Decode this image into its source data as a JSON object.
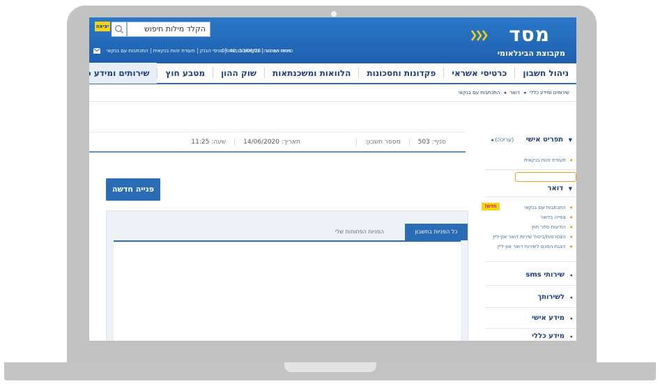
{
  "header": {
    "brand_name": "מסד",
    "brand_subtitle": "מקבוצת הבינלאומי",
    "search_placeholder": "הקלד מילות חיפוש",
    "exit_label": "יציאה",
    "last_login_label": "כניסה אחרונה:",
    "last_login_value": "10/06/20 ,08:40",
    "quick_links": [
      "פניות הציבור",
      "בנקאות בנחמה",
      "סניפי הבנק",
      "תעודת זהות בנקאית",
      "התכתבות עם בנקאי"
    ]
  },
  "mainnav": {
    "items": [
      "ניהול חשבון",
      "כרטיסי אשראי",
      "פקדונות וחסכונות",
      "הלוואות ומשכנתאות",
      "שוק ההון",
      "מטבע חוץ",
      "שירותים ומידע כללי"
    ]
  },
  "breadcrumb": [
    "שירותים ומידע כללי",
    "דואר",
    "התכתבות עם בנקאי"
  ],
  "info_bar": {
    "branch_label": "סניף:",
    "branch_value": "503",
    "account_label": "מספר חשבון:",
    "account_value": "",
    "date_label": "תאריך:",
    "date_value": "14/06/2020",
    "time_label": "שעה:",
    "time_value": "11:25"
  },
  "side": {
    "personal_profile": "תפריט אישי",
    "edit_label": "(עריכה)",
    "id_link": "תעודת זהות בנקאית",
    "mail_heading": "דואר",
    "mail_links": [
      "התכתבות עם בנקאי",
      "צפייה בדואר",
      "הודעות סחר חוץ",
      "הצטרפות/ביטול שירות דואר און-ליין",
      "הצגת הסכם לשירות דואר און-ליין"
    ],
    "new_badge": "חדש!",
    "menu_items": [
      "שירותי sms",
      "לשירותך",
      "מידע אישי",
      "מידע כללי"
    ]
  },
  "main": {
    "new_request_label": "פנייה חדשה",
    "tabs": [
      "כל הפניות בחשבון",
      "הפניות הפתוחות שלי"
    ]
  }
}
